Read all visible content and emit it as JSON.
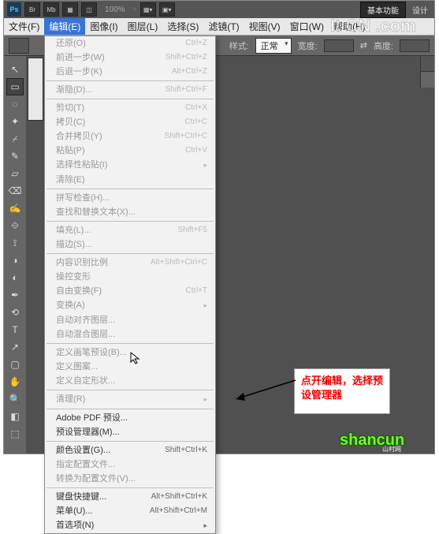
{
  "appbar": {
    "ps": "Ps",
    "buttons": [
      "Br",
      "Mb",
      "▦",
      "◫"
    ],
    "zoom": "100%",
    "basic": "基本功能",
    "design": "设计"
  },
  "menubar": {
    "items": [
      "文件(F)",
      "编辑(E)",
      "图像(I)",
      "图层(L)",
      "选择(S)",
      "滤镜(T)",
      "视图(V)",
      "窗口(W)",
      "帮助(H)"
    ]
  },
  "optbar": {
    "style_label": "样式:",
    "style_value": "正常",
    "width_label": "宽度:",
    "height_label": "高度:"
  },
  "menu": {
    "groups": [
      [
        {
          "label": "还原(O)",
          "shortcut": "Ctrl+Z",
          "disabled": true
        },
        {
          "label": "前进一步(W)",
          "shortcut": "Shift+Ctrl+Z",
          "disabled": true
        },
        {
          "label": "后退一步(K)",
          "shortcut": "Alt+Ctrl+Z",
          "disabled": true
        }
      ],
      [
        {
          "label": "渐隐(D)...",
          "shortcut": "Shift+Ctrl+F",
          "disabled": true
        }
      ],
      [
        {
          "label": "剪切(T)",
          "shortcut": "Ctrl+X",
          "disabled": true
        },
        {
          "label": "拷贝(C)",
          "shortcut": "Ctrl+C",
          "disabled": true
        },
        {
          "label": "合并拷贝(Y)",
          "shortcut": "Shift+Ctrl+C",
          "disabled": true
        },
        {
          "label": "粘贴(P)",
          "shortcut": "Ctrl+V",
          "disabled": true
        },
        {
          "label": "选择性粘贴(I)",
          "shortcut": "",
          "sub": true,
          "disabled": true
        },
        {
          "label": "清除(E)",
          "shortcut": "",
          "disabled": true
        }
      ],
      [
        {
          "label": "拼写检查(H)...",
          "shortcut": "",
          "disabled": true
        },
        {
          "label": "查找和替换文本(X)...",
          "shortcut": "",
          "disabled": true
        }
      ],
      [
        {
          "label": "填充(L)...",
          "shortcut": "Shift+F5",
          "disabled": true
        },
        {
          "label": "描边(S)...",
          "shortcut": "",
          "disabled": true
        }
      ],
      [
        {
          "label": "内容识别比例",
          "shortcut": "Alt+Shift+Ctrl+C",
          "disabled": true
        },
        {
          "label": "操控变形",
          "shortcut": "",
          "disabled": true
        },
        {
          "label": "自由变换(F)",
          "shortcut": "Ctrl+T",
          "disabled": true
        },
        {
          "label": "变换(A)",
          "shortcut": "",
          "sub": true,
          "disabled": true
        },
        {
          "label": "自动对齐图层...",
          "shortcut": "",
          "disabled": true
        },
        {
          "label": "自动混合图层...",
          "shortcut": "",
          "disabled": true
        }
      ],
      [
        {
          "label": "定义画笔预设(B)...",
          "shortcut": "",
          "disabled": true
        },
        {
          "label": "定义图案...",
          "shortcut": "",
          "disabled": true
        },
        {
          "label": "定义自定形状...",
          "shortcut": "",
          "disabled": true
        }
      ],
      [
        {
          "label": "清理(R)",
          "shortcut": "",
          "sub": true,
          "disabled": true
        }
      ],
      [
        {
          "label": "Adobe PDF 预设...",
          "shortcut": "",
          "disabled": false
        },
        {
          "label": "预设管理器(M)...",
          "shortcut": "",
          "disabled": false
        }
      ],
      [
        {
          "label": "颜色设置(G)...",
          "shortcut": "Shift+Ctrl+K",
          "disabled": false
        },
        {
          "label": "指定配置文件...",
          "shortcut": "",
          "disabled": true
        },
        {
          "label": "转换为配置文件(V)...",
          "shortcut": "",
          "disabled": true
        }
      ],
      [
        {
          "label": "键盘快捷键...",
          "shortcut": "Alt+Shift+Ctrl+K",
          "disabled": false
        },
        {
          "label": "菜单(U)...",
          "shortcut": "Alt+Shift+Ctrl+M",
          "disabled": false
        },
        {
          "label": "首选项(N)",
          "shortcut": "",
          "sub": true,
          "disabled": false
        }
      ]
    ]
  },
  "annotation": {
    "text": "点开编辑，选择预设管理器"
  },
  "tools": [
    "↖",
    "▭",
    "◌",
    "✦",
    "⌿",
    "✎",
    "▱",
    "⌫",
    "✍",
    "⟐",
    "⟟",
    "◑",
    "◐",
    "✒",
    "⟲",
    "T",
    "↗",
    "▢",
    "✋",
    "🔍",
    "◧",
    "⬚"
  ]
}
